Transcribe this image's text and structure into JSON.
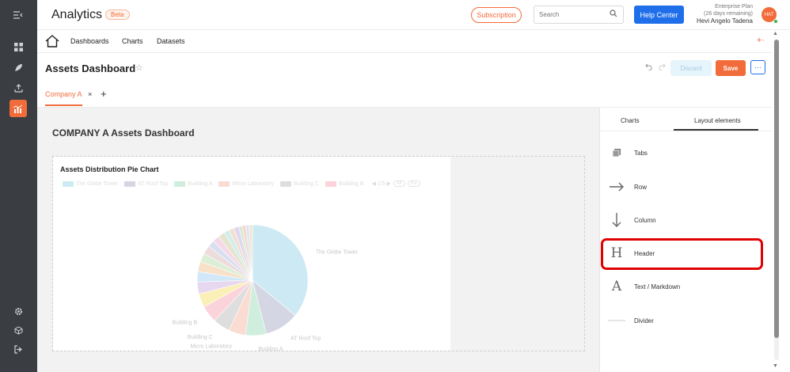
{
  "app": {
    "title": "Analytics",
    "badge": "Beta",
    "subscription_label": "Subscription",
    "search_placeholder": "Search",
    "help_label": "Help Center",
    "plan_line1": "Enterprise Plan",
    "plan_line2": "(26 days remaining)",
    "user_name": "Hevi Angelo Tadena",
    "avatar_initials": "HAT",
    "accent_color": "#f26b3a",
    "primary_color": "#1f6feb"
  },
  "nav": {
    "links": [
      "Dashboards",
      "Charts",
      "Datasets"
    ],
    "add_symbol": "+·"
  },
  "titlebar": {
    "title": "Assets Dashboard",
    "star": "☆",
    "discard_label": "Discard",
    "save_label": "Save",
    "more_label": "···"
  },
  "tabs": {
    "active": "Company A",
    "close": "×",
    "add": "+"
  },
  "dashboard": {
    "header": "COMPANY A Assets Dashboard"
  },
  "chart_data": {
    "type": "pie",
    "title": "Assets Distribution Pie Chart",
    "legend_page": "1/5",
    "legend_controls": [
      "All",
      "Inv"
    ],
    "categories": [
      "The Globe Tower",
      "AT Roof Top",
      "Building A",
      "Micro Laboratory",
      "Building C",
      "Building B"
    ],
    "values": [
      36,
      10,
      6,
      5,
      5,
      5
    ],
    "other_slices": [
      4,
      3.5,
      3,
      3,
      2.5,
      2.5,
      2,
      2,
      2,
      1.5,
      1.5,
      1.5,
      1,
      1,
      1,
      1
    ],
    "colors": [
      "#cdeaf4",
      "#d4d6e3",
      "#cfeedd",
      "#fbdcd2",
      "#dedede",
      "#fbd3db"
    ],
    "other_colors": [
      "#fbefb8",
      "#e7d8ef",
      "#d2e8f8",
      "#f7e1c9",
      "#dcefd6",
      "#eddcdc",
      "#d8dff2",
      "#f5d9e6",
      "#e4e4cf",
      "#d3ecec",
      "#f0e0d0",
      "#e0d6f0",
      "#d9ead3",
      "#f3d7cf",
      "#dde6ee",
      "#efe6d6"
    ],
    "slice_labels": [
      "The Globe Tower",
      "AT Roof Top",
      "Building A",
      "Micro Laboratory",
      "Building C",
      "Building B"
    ]
  },
  "panel": {
    "tabs": [
      "Charts",
      "Layout elements"
    ],
    "items": [
      {
        "label": "Tabs",
        "icon": "tabs-icon"
      },
      {
        "label": "Row",
        "icon": "arrow-right-icon"
      },
      {
        "label": "Column",
        "icon": "arrow-down-icon"
      },
      {
        "label": "Header",
        "icon": "header-h-icon"
      },
      {
        "label": "Text / Markdown",
        "icon": "text-a-icon"
      },
      {
        "label": "Divider",
        "icon": "divider-icon"
      }
    ]
  },
  "rail_icons": [
    "collapse-icon",
    "dashboard-grid-icon",
    "rocket-icon",
    "upload-icon",
    "chart-icon",
    "settings-icon",
    "cube-icon",
    "logout-icon"
  ]
}
